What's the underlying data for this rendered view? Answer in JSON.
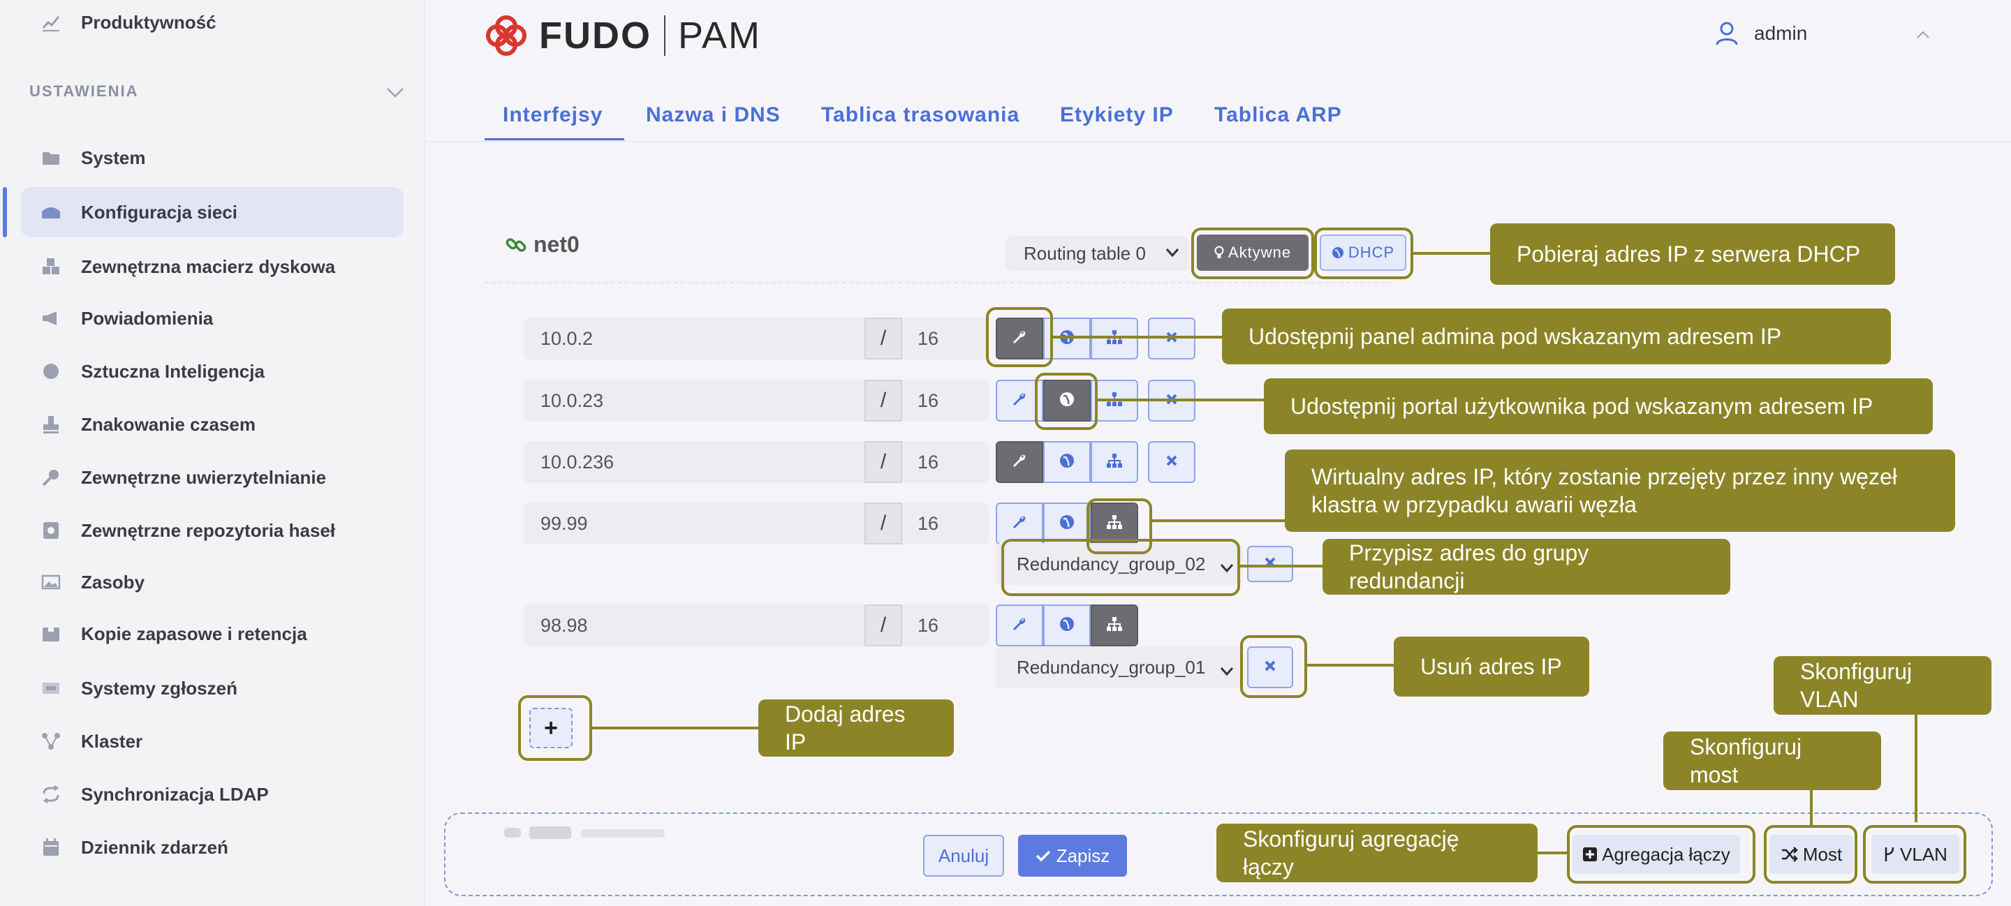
{
  "sidebar": {
    "top_item": "Produktywność",
    "section_title": "USTAWIENIA",
    "items": [
      {
        "label": "System",
        "icon": "folder-icon"
      },
      {
        "label": "Konfiguracja sieci",
        "icon": "network-icon"
      },
      {
        "label": "Zewnętrzna macierz dyskowa",
        "icon": "storage-icon"
      },
      {
        "label": "Powiadomienia",
        "icon": "megaphone-icon"
      },
      {
        "label": "Sztuczna Inteligencja",
        "icon": "brain-icon"
      },
      {
        "label": "Znakowanie czasem",
        "icon": "stamp-icon"
      },
      {
        "label": "Zewnętrzne uwierzytelnianie",
        "icon": "key-icon"
      },
      {
        "label": "Zewnętrzne repozytoria haseł",
        "icon": "vault-icon"
      },
      {
        "label": "Zasoby",
        "icon": "image-icon"
      },
      {
        "label": "Kopie zapasowe i retencja",
        "icon": "archive-icon"
      },
      {
        "label": "Systemy zgłoszeń",
        "icon": "ticket-icon"
      },
      {
        "label": "Klaster",
        "icon": "cluster-icon"
      },
      {
        "label": "Synchronizacja LDAP",
        "icon": "sync-icon"
      },
      {
        "label": "Dziennik zdarzeń",
        "icon": "calendar-icon"
      }
    ]
  },
  "header": {
    "logo_word1": "FUDO",
    "logo_word2": "PAM",
    "user": "admin"
  },
  "tabs": [
    "Interfejsy",
    "Nazwa i DNS",
    "Tablica trasowania",
    "Etykiety IP",
    "Tablica ARP"
  ],
  "interface": {
    "name": "net0",
    "routing_table": "Routing table 0",
    "active_label": "Aktywne",
    "dhcp_label": "DHCP"
  },
  "addresses": [
    {
      "ip": "10.0.2",
      "mask": "16"
    },
    {
      "ip": "10.0.23",
      "mask": "16"
    },
    {
      "ip": "10.0.236",
      "mask": "16"
    },
    {
      "ip": "99.99",
      "mask": "16",
      "redundancy_group": "Redundancy_group_02"
    },
    {
      "ip": "98.98",
      "mask": "16",
      "redundancy_group": "Redundancy_group_01"
    }
  ],
  "footer": {
    "cancel": "Anuluj",
    "save": "Zapisz",
    "aggregation": "Agregacja łączy",
    "bridge": "Most",
    "vlan": "VLAN"
  },
  "callouts": {
    "dhcp": "Pobieraj adres IP z serwera DHCP",
    "admin_panel": "Udostępnij panel admina pod wskazanym adresem IP",
    "user_portal": "Udostępnij portal użytkownika pod wskazanym adresem IP",
    "virtual_ip": "Wirtualny adres IP, który zostanie przejęty przez inny węzeł klastra w przypadku awarii węzła",
    "redundancy": "Przypisz adres do grupy redundancji",
    "delete": "Usuń adres IP",
    "add": "Dodaj adres IP",
    "vlan": "Skonfiguruj VLAN",
    "bridge": "Skonfiguruj most",
    "aggregation": "Skonfiguruj agregację łączy"
  },
  "colors": {
    "accent": "#4b6fd6",
    "callout": "#8c8527",
    "active_button": "#6c6c72"
  }
}
